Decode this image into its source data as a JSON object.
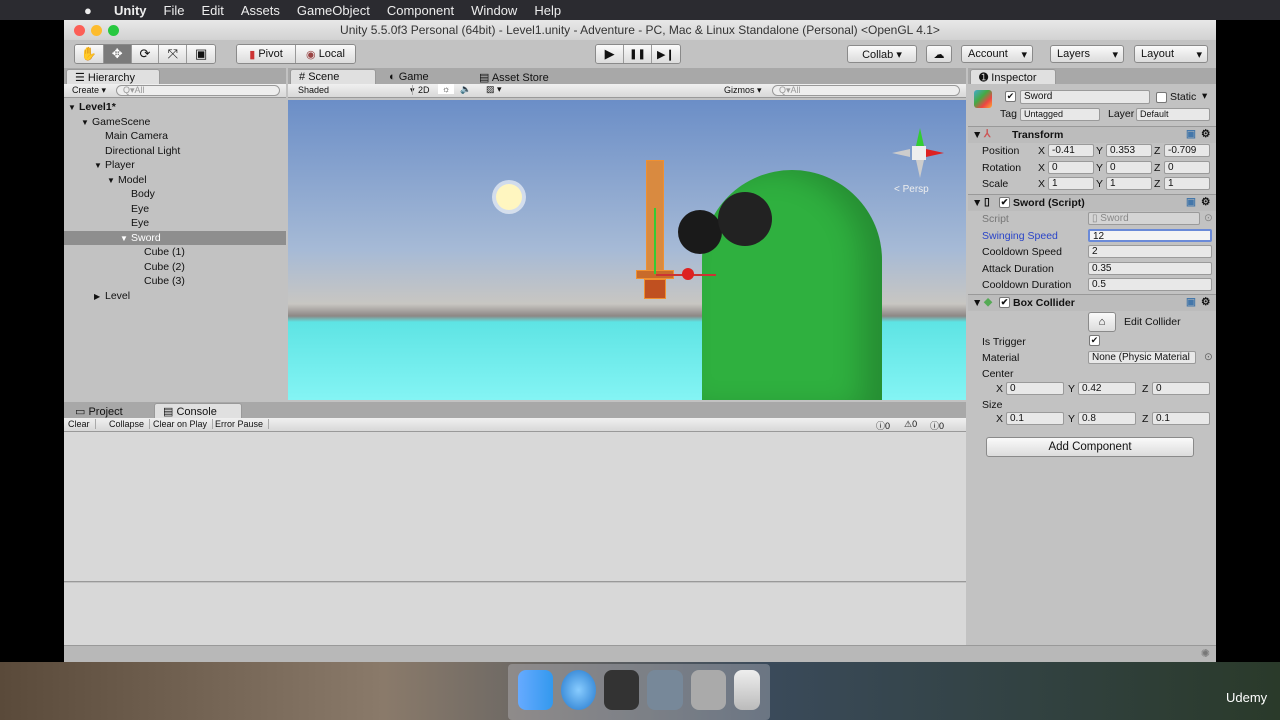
{
  "menubar": {
    "apple": "",
    "items": [
      "Unity",
      "File",
      "Edit",
      "Assets",
      "GameObject",
      "Component",
      "Window",
      "Help"
    ]
  },
  "window": {
    "title": "Unity 5.5.0f3 Personal (64bit) - Level1.unity - Adventure - PC, Mac & Linux Standalone (Personal) <OpenGL 4.1>"
  },
  "toolbar": {
    "tools": [
      "hand-icon",
      "move-icon",
      "rotate-icon",
      "scale-icon",
      "rect-icon"
    ],
    "active_tool": 1,
    "pivot": "Pivot",
    "local": "Local",
    "play": "▶",
    "pause": "❚❚",
    "step": "▶❙",
    "collab": "Collab ▾",
    "account": "Account",
    "layers": "Layers",
    "layout": "Layout"
  },
  "hierarchy": {
    "tab": "Hierarchy",
    "create": "Create ▾",
    "search_placeholder": "All",
    "items": [
      {
        "label": "Level1*",
        "depth": 0,
        "arrow": "▼",
        "bold": true
      },
      {
        "label": "GameScene",
        "depth": 1,
        "arrow": "▼"
      },
      {
        "label": "Main Camera",
        "depth": 2,
        "arrow": ""
      },
      {
        "label": "Directional Light",
        "depth": 2,
        "arrow": ""
      },
      {
        "label": "Player",
        "depth": 2,
        "arrow": "▼"
      },
      {
        "label": "Model",
        "depth": 3,
        "arrow": "▼"
      },
      {
        "label": "Body",
        "depth": 4,
        "arrow": ""
      },
      {
        "label": "Eye",
        "depth": 4,
        "arrow": ""
      },
      {
        "label": "Eye",
        "depth": 4,
        "arrow": ""
      },
      {
        "label": "Sword",
        "depth": 4,
        "arrow": "▼",
        "selected": true
      },
      {
        "label": "Cube (1)",
        "depth": 5,
        "arrow": ""
      },
      {
        "label": "Cube (2)",
        "depth": 5,
        "arrow": ""
      },
      {
        "label": "Cube (3)",
        "depth": 5,
        "arrow": ""
      },
      {
        "label": "Level",
        "depth": 2,
        "arrow": "▶"
      }
    ]
  },
  "scene": {
    "tabs": [
      "Scene",
      "Game",
      "Asset Store"
    ],
    "shading": "Shaded",
    "mode2d": "2D",
    "gizmos": "Gizmos ▾",
    "search_placeholder": "All",
    "persp": "< Persp"
  },
  "console": {
    "tabs": [
      "Project",
      "Console"
    ],
    "buttons": [
      "Clear",
      "Collapse",
      "Clear on Play",
      "Error Pause"
    ],
    "counts": [
      "0",
      "0",
      "0"
    ]
  },
  "inspector": {
    "tab": "Inspector",
    "name": "Sword",
    "static": "Static",
    "tag_label": "Tag",
    "tag": "Untagged",
    "layer_label": "Layer",
    "layer": "Default",
    "transform": {
      "title": "Transform",
      "rows": [
        {
          "label": "Position",
          "x": "-0.41",
          "y": "0.353",
          "z": "-0.709"
        },
        {
          "label": "Rotation",
          "x": "0",
          "y": "0",
          "z": "0"
        },
        {
          "label": "Scale",
          "x": "1",
          "y": "1",
          "z": "1"
        }
      ]
    },
    "script": {
      "title": "Sword (Script)",
      "script_label": "Script",
      "script_value": "Sword",
      "fields": [
        {
          "label": "Swinging Speed",
          "value": "12"
        },
        {
          "label": "Cooldown Speed",
          "value": "2"
        },
        {
          "label": "Attack Duration",
          "value": "0.35"
        },
        {
          "label": "Cooldown Duration",
          "value": "0.5"
        }
      ]
    },
    "collider": {
      "title": "Box Collider",
      "edit": "Edit Collider",
      "trigger_label": "Is Trigger",
      "material_label": "Material",
      "material": "None (Physic Material",
      "center_label": "Center",
      "center": {
        "x": "0",
        "y": "0.42",
        "z": "0"
      },
      "size_label": "Size",
      "size": {
        "x": "0.1",
        "y": "0.8",
        "z": "0.1"
      }
    },
    "add_component": "Add Component"
  },
  "watermark": "Udemy"
}
